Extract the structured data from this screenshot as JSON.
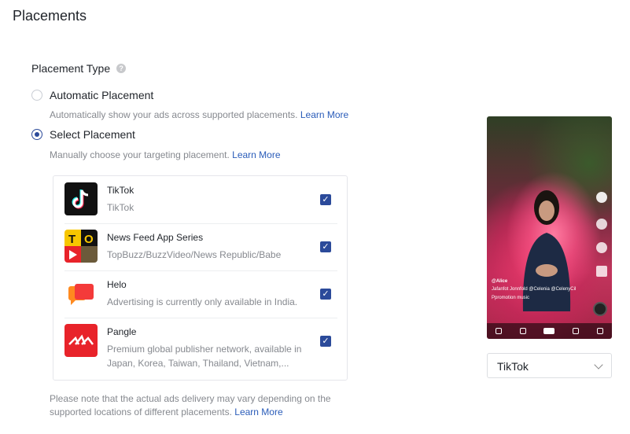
{
  "page": {
    "title": "Placements"
  },
  "placement_type": {
    "label": "Placement Type",
    "help_icon": "question-circle-icon"
  },
  "options": {
    "automatic": {
      "label": "Automatic Placement",
      "description": "Automatically show your ads across supported placements.",
      "link": "Learn More",
      "selected": false
    },
    "select": {
      "label": "Select Placement",
      "description": "Manually choose your targeting placement.",
      "link": "Learn More",
      "selected": true
    }
  },
  "placements": [
    {
      "name": "TikTok",
      "sub": "TikTok",
      "checked": true,
      "icon": "tiktok-logo-icon"
    },
    {
      "name": "News Feed App Series",
      "sub": "TopBuzz/BuzzVideo/News Republic/Babe",
      "checked": true,
      "icon": "news-feed-logo-icon"
    },
    {
      "name": "Helo",
      "sub": "Advertising is currently only available in India.",
      "checked": true,
      "icon": "helo-logo-icon"
    },
    {
      "name": "Pangle",
      "sub": "Premium global publisher network, available in Japan, Korea, Taiwan, Thailand, Vietnam,...",
      "checked": true,
      "icon": "pangle-logo-icon"
    }
  ],
  "note": {
    "text": "Please note that the actual ads delivery may vary depending on the supported locations of different placements.",
    "link": "Learn More"
  },
  "preview": {
    "username": "@Alice",
    "caption": "Jafanfot Jonnfold @Celenia @CelenyCil",
    "sound": "Ppromotion music"
  },
  "preview_select": {
    "value": "TikTok"
  },
  "colors": {
    "accent": "#2b4a9a",
    "link": "#2a5cb9",
    "muted": "#86898f"
  }
}
